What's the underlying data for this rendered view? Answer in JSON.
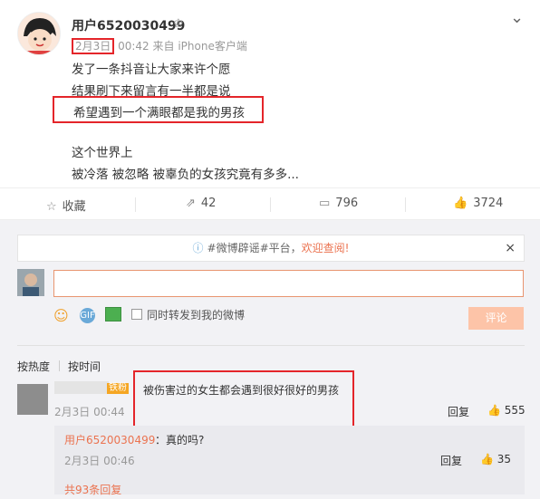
{
  "post": {
    "username": "用户6520030499",
    "date": "2月3日",
    "time_source": "00:42 来自 iPhone客户端",
    "lines": [
      "发了一条抖音让大家来许个愿",
      "结果刷下来留言有一半都是说",
      "希望遇到一个满眼都是我的男孩",
      "这个世界上",
      "被冷落 被忽略 被辜负的女孩究竟有多多..."
    ]
  },
  "actions": {
    "collect": "收藏",
    "forward": "42",
    "comment": "796",
    "like": "3724"
  },
  "notice": {
    "prefix": "#微博辟谣#平台，",
    "highlight": "欢迎查阅!"
  },
  "composer": {
    "sync_label": "同时转发到我的微博",
    "submit_label": "评论"
  },
  "sort": {
    "by_hot": "按热度",
    "by_time": "按时间"
  },
  "comment": {
    "fan_badge": "铁粉",
    "text": "被伤害过的女生都会遇到很好很好的男孩",
    "date": "2月3日 00:44",
    "reply_label": "回复",
    "likes": "555"
  },
  "sub_comment": {
    "name": "用户6520030499",
    "text": "：真的吗?",
    "date": "2月3日 00:46",
    "reply_label": "回复",
    "likes": "35"
  },
  "more_replies": "共93条回复"
}
